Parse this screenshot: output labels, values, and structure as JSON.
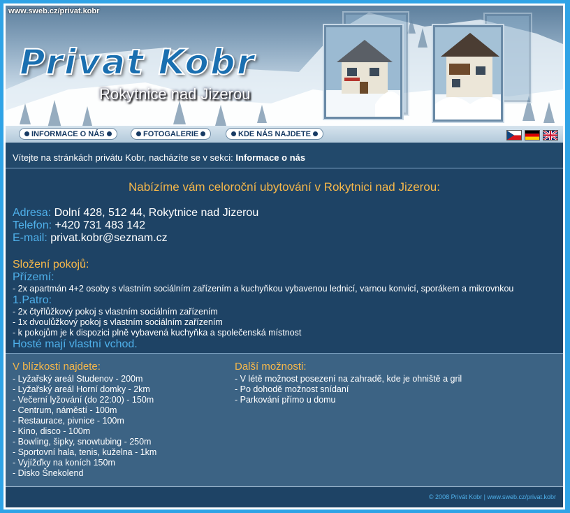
{
  "header": {
    "url_label": "www.sweb.cz/privat.kobr",
    "logo_title": "Privat Kobr",
    "logo_subtitle": "Rokytnice nad Jizerou"
  },
  "nav": {
    "items": [
      {
        "label": "INFORMACE O NÁS"
      },
      {
        "label": "FOTOGALERIE"
      },
      {
        "label": "KDE NÁS NAJDETE"
      }
    ],
    "flags": [
      "czech-flag",
      "german-flag",
      "uk-flag"
    ]
  },
  "welcome": {
    "text": "Vítejte na stránkách privátu Kobr, nacházíte se v sekci:",
    "section": "Informace o nás"
  },
  "main": {
    "heading": "Nabízíme vám celoroční ubytování v Rokytnici nad Jizerou:",
    "contact": {
      "address_label": "Adresa:",
      "address": "Dolní 428, 512 44, Rokytnice nad Jizerou",
      "phone_label": "Telefon:",
      "phone": "+420 731 483 142",
      "email_label": "E-mail:",
      "email": "privat.kobr@seznam.cz"
    },
    "rooms_title": "Složení pokojů:",
    "ground_floor_title": "Přízemí:",
    "ground_floor": [
      "- 2x apartmán 4+2 osoby s vlastním sociálním zařízením a kuchyňkou vybavenou lednicí, varnou konvicí, sporákem a mikrovnkou"
    ],
    "first_floor_title": "1.Patro:",
    "first_floor": [
      "- 2x čtyřlůžkový pokoj s vlastním sociálním zařízením",
      "- 1x dvoulůžkový pokoj s vlastním sociálním zařízením",
      "- k pokojům je k dispozici plně vybavená kuchyňka a společenská místnost"
    ],
    "guests_note": "Hosté mají vlastní vchod."
  },
  "nearby": {
    "title": "V blízkosti najdete:",
    "items": [
      "- Lyžařský areál Studenov - 200m",
      "- Lyžařský areál Horní domky - 2km",
      "- Večerní lyžování (do 22:00) - 150m",
      "- Centrum, náměstí - 100m",
      "- Restaurace, pivnice - 100m",
      "- Kino, disco - 100m",
      "- Bowling, šipky, snowtubing - 250m",
      "- Sportovní hala, tenis, kuželna - 1km",
      "- Vyjížďky na koních 150m",
      "- Disko Šnekolend"
    ]
  },
  "options": {
    "title": "Další možnosti:",
    "items": [
      "- V létě možnost posezení na zahradě, kde je ohniště a gril",
      "- Po dohodě možnost snídaní",
      "- Parkování přímo u domu"
    ]
  },
  "footer": {
    "copyright": "© 2008 Privát Kobr",
    "separator": "|",
    "url": "www.sweb.cz/privat.kobr"
  }
}
